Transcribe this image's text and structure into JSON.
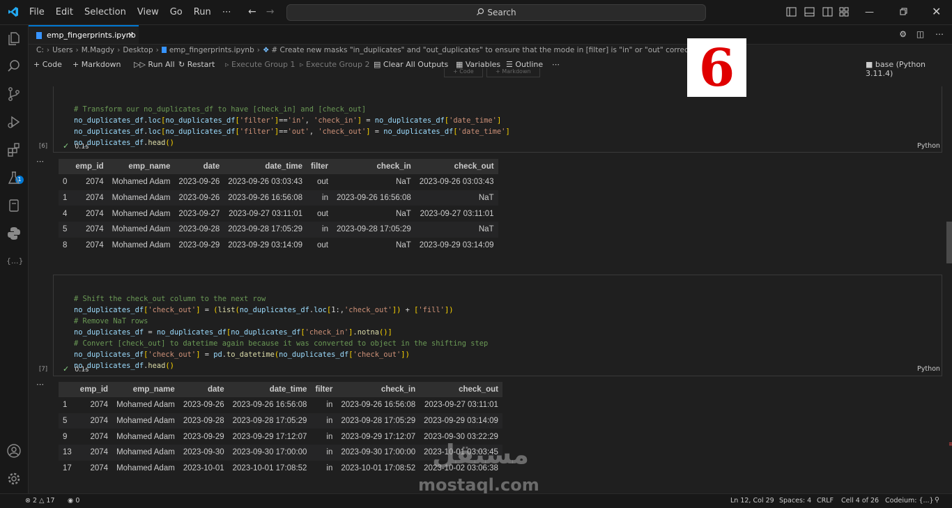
{
  "menu": [
    "File",
    "Edit",
    "Selection",
    "View",
    "Go",
    "Run",
    "⋯"
  ],
  "search": {
    "label": "Search"
  },
  "tab": {
    "label": "emp_fingerprints.ipynb",
    "close": "×"
  },
  "breadcrumb": [
    "C:",
    "Users",
    "M.Magdy",
    "Desktop",
    "emp_fingerprints.ipynb",
    "# Create new masks \"in_duplicates\" and \"out_duplicates\" to ensure that the mode in [filter] is \"in\" or \"out\" correctly"
  ],
  "toolbar": {
    "code": "Code",
    "markdown": "Markdown",
    "run_all": "Run All",
    "restart": "Restart",
    "exec_group1": "Execute Group 1",
    "exec_group2": "Execute Group 2",
    "clear_outputs": "Clear All Outputs",
    "variables": "Variables",
    "outline": "Outline",
    "more": "⋯",
    "kernel": "base (Python 3.11.4)",
    "mini_code": "Code",
    "mini_markdown": "Markdown"
  },
  "badge": "6",
  "cell1": {
    "exec_count": "[6]",
    "timing": "0.1s",
    "lang": "Python",
    "lines": [
      "# Transform our no_duplicates_df to have [check_in] and [check_out]",
      "no_duplicates_df.loc[no_duplicates_df['filter']=='in', 'check_in'] = no_duplicates_df['date_time']",
      "no_duplicates_df.loc[no_duplicates_df['filter']=='out', 'check_out'] = no_duplicates_df['date_time']",
      "no_duplicates_df.head()"
    ]
  },
  "table1": {
    "headers": [
      "",
      "emp_id",
      "emp_name",
      "date",
      "date_time",
      "filter",
      "check_in",
      "check_out"
    ],
    "rows": [
      [
        "0",
        "2074",
        "Mohamed Adam",
        "2023-09-26",
        "2023-09-26 03:03:43",
        "out",
        "NaT",
        "2023-09-26 03:03:43"
      ],
      [
        "1",
        "2074",
        "Mohamed Adam",
        "2023-09-26",
        "2023-09-26 16:56:08",
        "in",
        "2023-09-26 16:56:08",
        "NaT"
      ],
      [
        "4",
        "2074",
        "Mohamed Adam",
        "2023-09-27",
        "2023-09-27 03:11:01",
        "out",
        "NaT",
        "2023-09-27 03:11:01"
      ],
      [
        "5",
        "2074",
        "Mohamed Adam",
        "2023-09-28",
        "2023-09-28 17:05:29",
        "in",
        "2023-09-28 17:05:29",
        "NaT"
      ],
      [
        "8",
        "2074",
        "Mohamed Adam",
        "2023-09-29",
        "2023-09-29 03:14:09",
        "out",
        "NaT",
        "2023-09-29 03:14:09"
      ]
    ]
  },
  "cell2": {
    "exec_count": "[7]",
    "timing": "0.1s",
    "lang": "Python",
    "lines": [
      "# Shift the check_out column to the next row",
      "no_duplicates_df['check_out'] = (list(no_duplicates_df.loc[1:,'check_out']) + ['fill'])",
      "# Remove NaT rows",
      "no_duplicates_df = no_duplicates_df[no_duplicates_df['check_in'].notna()]",
      "# Convert [check_out] to datetime again because it was converted to object in the shifting step",
      "no_duplicates_df['check_out'] = pd.to_datetime(no_duplicates_df['check_out'])",
      "no_duplicates_df.head()"
    ]
  },
  "table2": {
    "headers": [
      "",
      "emp_id",
      "emp_name",
      "date",
      "date_time",
      "filter",
      "check_in",
      "check_out"
    ],
    "rows": [
      [
        "1",
        "2074",
        "Mohamed Adam",
        "2023-09-26",
        "2023-09-26 16:56:08",
        "in",
        "2023-09-26 16:56:08",
        "2023-09-27 03:11:01"
      ],
      [
        "5",
        "2074",
        "Mohamed Adam",
        "2023-09-28",
        "2023-09-28 17:05:29",
        "in",
        "2023-09-28 17:05:29",
        "2023-09-29 03:14:09"
      ],
      [
        "9",
        "2074",
        "Mohamed Adam",
        "2023-09-29",
        "2023-09-29 17:12:07",
        "in",
        "2023-09-29 17:12:07",
        "2023-09-30 03:22:29"
      ],
      [
        "13",
        "2074",
        "Mohamed Adam",
        "2023-09-30",
        "2023-09-30 17:00:00",
        "in",
        "2023-09-30 17:00:00",
        "2023-10-01 03:03:45"
      ],
      [
        "17",
        "2074",
        "Mohamed Adam",
        "2023-10-01",
        "2023-10-01 17:08:52",
        "in",
        "2023-10-01 17:08:52",
        "2023-10-02 03:06:38"
      ]
    ]
  },
  "ellipsis": "⋯",
  "statusbar": {
    "errors": "2",
    "warnings": "17",
    "ports": "0",
    "position": "Ln 12, Col 29",
    "spaces": "Spaces: 4",
    "eol": "CRLF",
    "cell": "Cell 4 of 26",
    "codeium": "Codeium: {...}"
  },
  "activity_badge": "1",
  "watermark": {
    "arabic": "مستقل",
    "latin": "mostaql.com"
  }
}
